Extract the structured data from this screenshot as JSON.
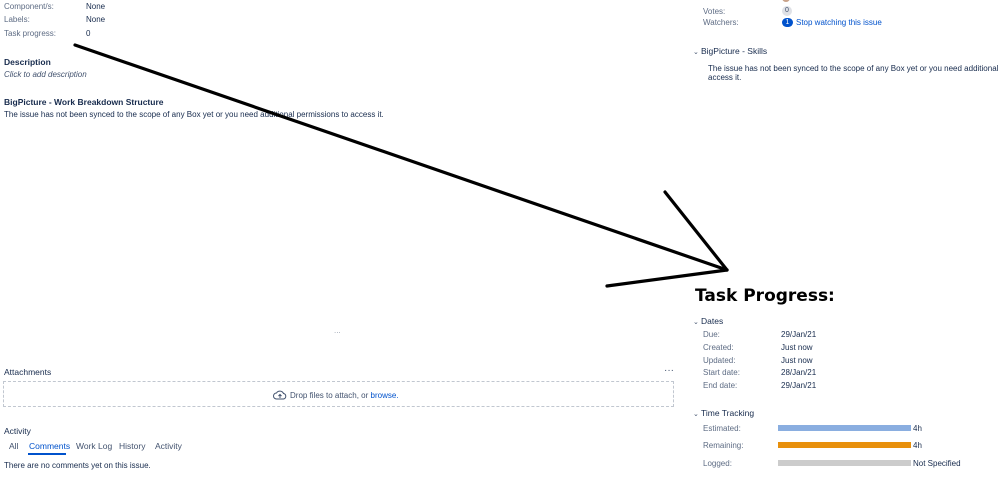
{
  "left": {
    "fields": [
      {
        "label": "Component/s:",
        "value": "None"
      },
      {
        "label": "Labels:",
        "value": "None"
      },
      {
        "label": "Task progress:",
        "value": "0"
      }
    ],
    "description": {
      "title": "Description",
      "placeholder": "Click to add description"
    },
    "wbs": {
      "title": "BigPicture - Work Breakdown Structure",
      "text": "The issue has not been synced to the scope of any Box yet or you need additional permissions to access it."
    },
    "ellipsis": "...",
    "attachments": {
      "title": "Attachments",
      "more": "···",
      "drop_text": "Drop files to attach, or",
      "browse": "browse."
    },
    "activity": {
      "title": "Activity",
      "tabs": [
        "All",
        "Comments",
        "Work Log",
        "History",
        "Activity"
      ],
      "active_tab": "Comments",
      "empty": "There are no comments yet on this issue."
    }
  },
  "right": {
    "votes": {
      "label": "Votes:",
      "count": "0"
    },
    "watchers": {
      "label": "Watchers:",
      "count": "1",
      "link": "Stop watching this issue"
    },
    "skills": {
      "title": "BigPicture - Skills",
      "text_line1": "The issue has not been synced to the scope of any Box yet or you need additional permis",
      "text_line2": "access it."
    },
    "annotation": "Task Progress:",
    "dates": {
      "title": "Dates",
      "rows": [
        {
          "label": "Due:",
          "value": "29/Jan/21"
        },
        {
          "label": "Created:",
          "value": "Just now"
        },
        {
          "label": "Updated:",
          "value": "Just now"
        },
        {
          "label": "Start date:",
          "value": "28/Jan/21"
        },
        {
          "label": "End date:",
          "value": "29/Jan/21"
        }
      ]
    },
    "time_tracking": {
      "title": "Time Tracking",
      "rows": [
        {
          "label": "Estimated:",
          "value": "4h",
          "fill": 1.0,
          "color": "#8aaee0"
        },
        {
          "label": "Remaining:",
          "value": "4h",
          "fill": 1.0,
          "color": "#e8900c"
        },
        {
          "label": "Logged:",
          "value": "Not Specified",
          "fill": 1.0,
          "color": "#cccccc"
        }
      ]
    }
  }
}
